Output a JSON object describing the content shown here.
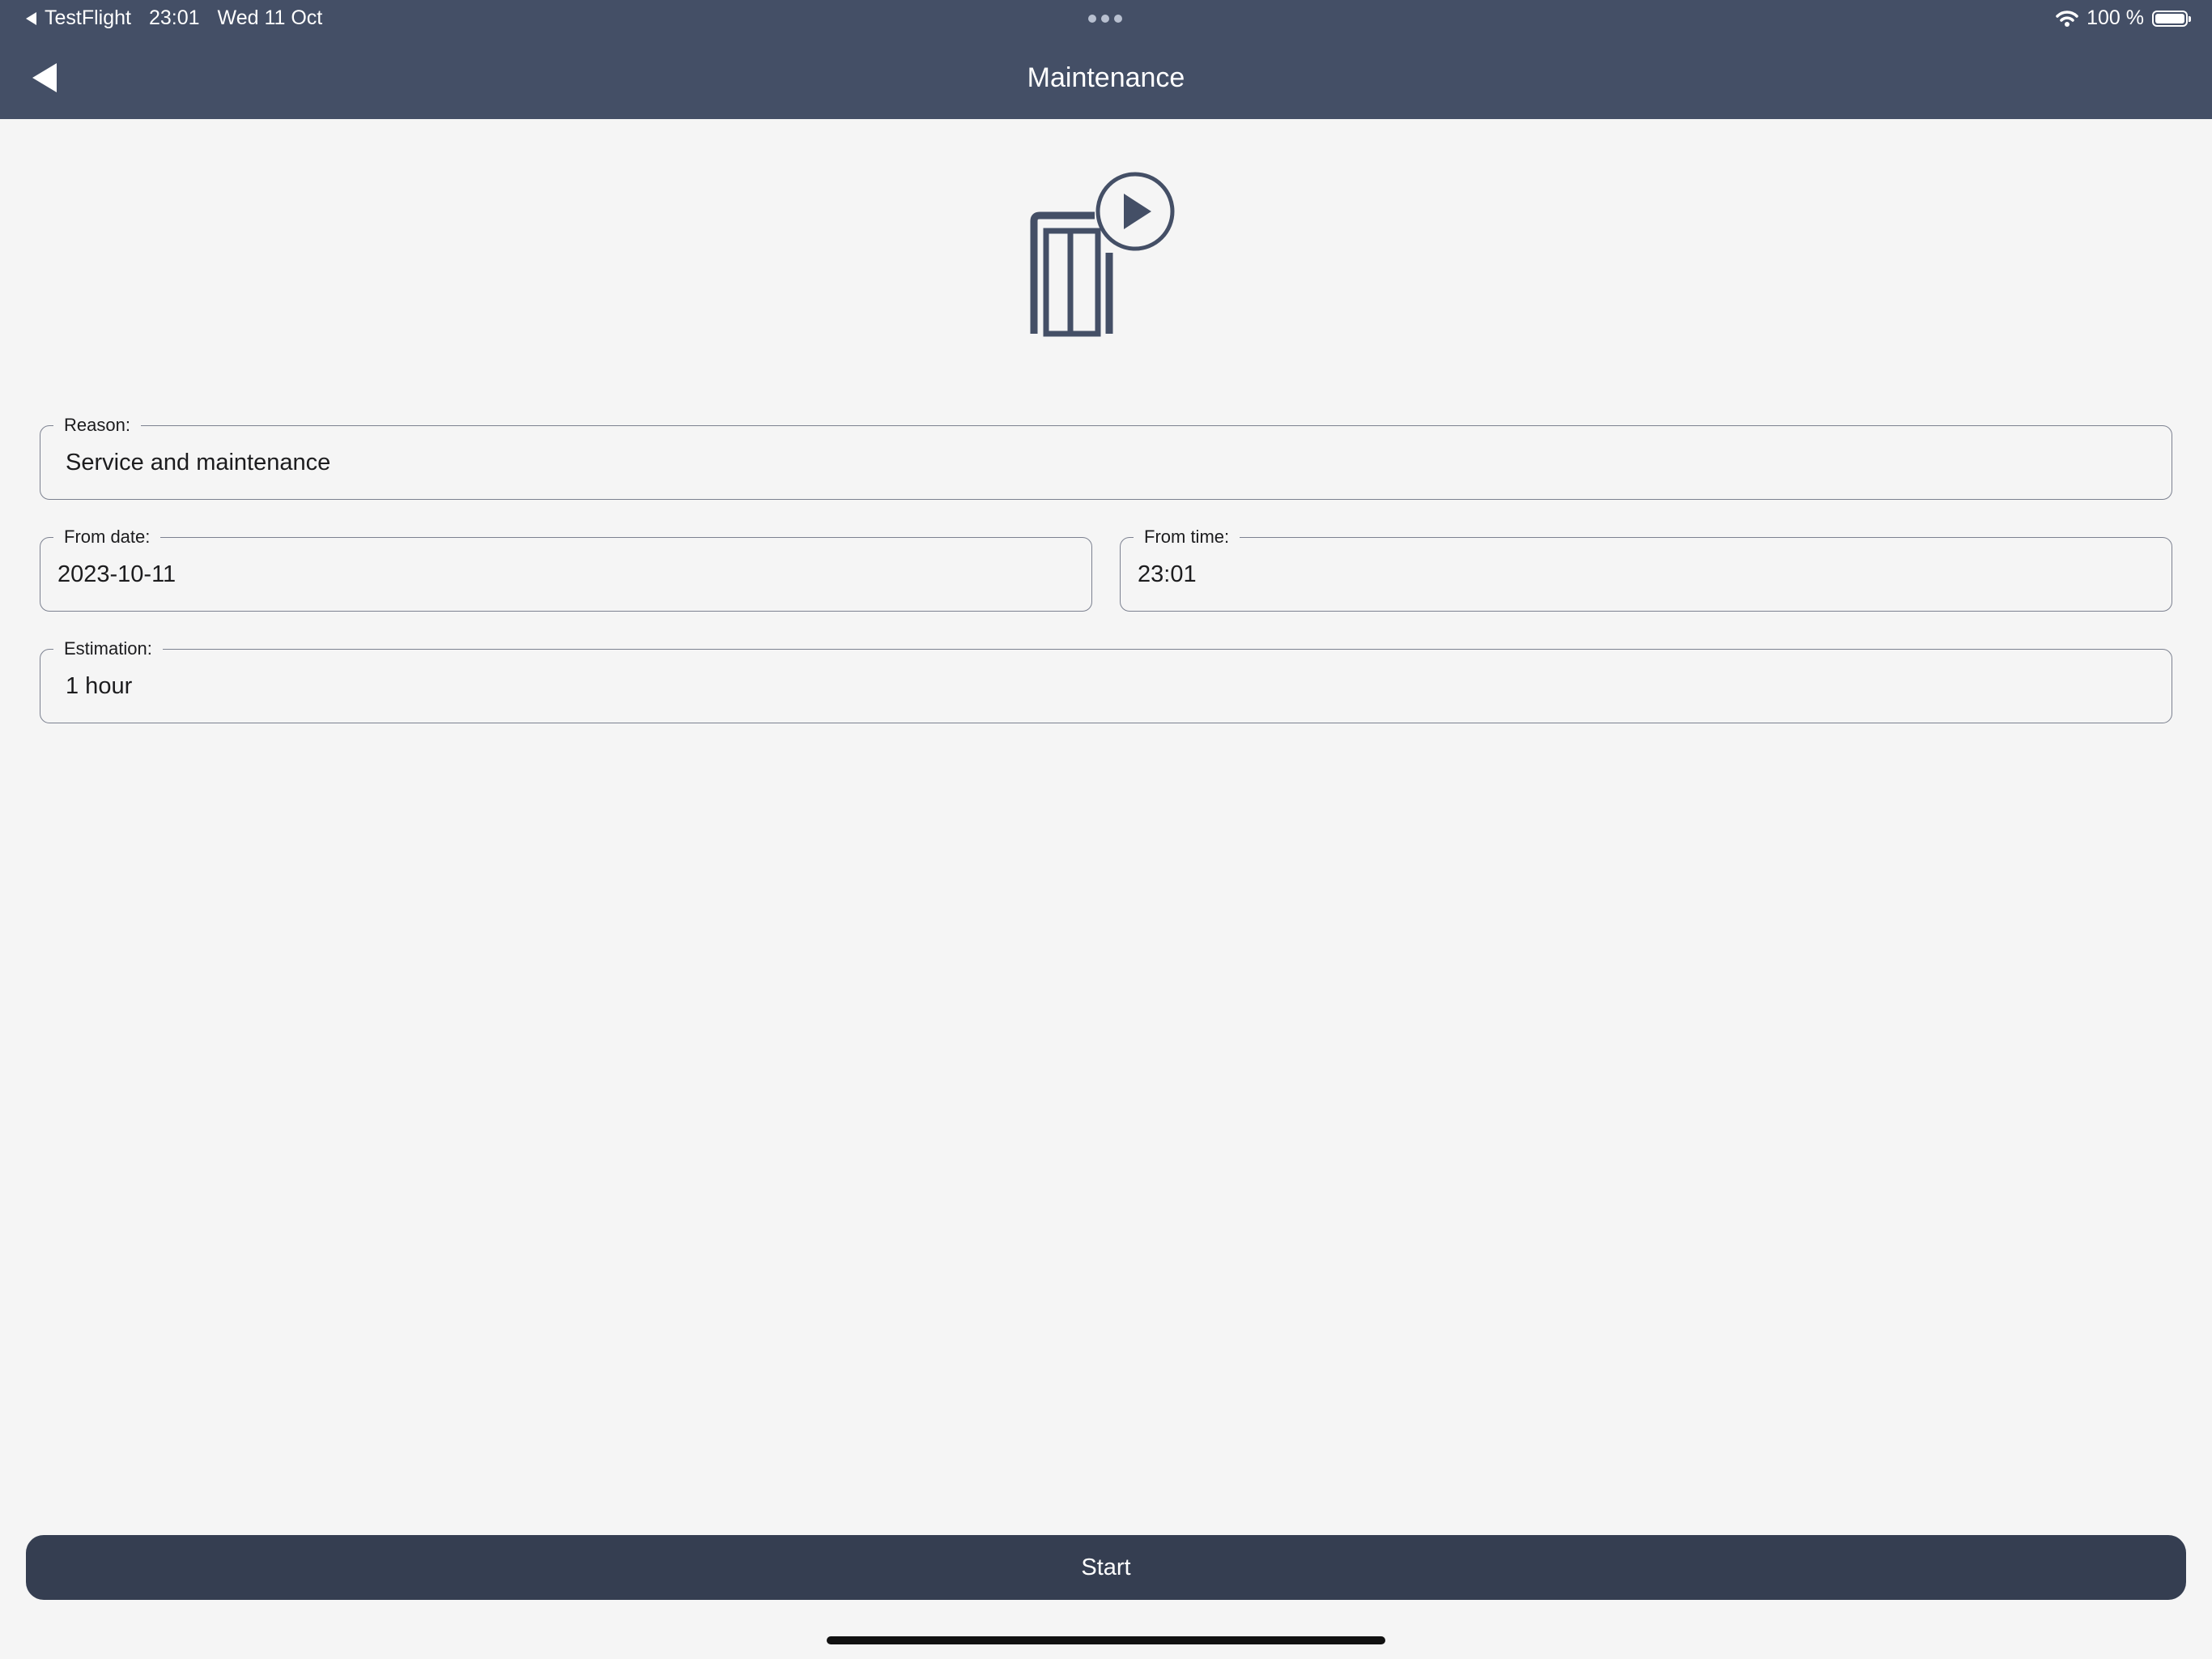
{
  "status_bar": {
    "back_app": "TestFlight",
    "time": "23:01",
    "date": "Wed 11 Oct",
    "battery": "100 %",
    "battery_level": 1.0,
    "wifi_icon": "wifi-icon",
    "multitask_icon": "more-dots-icon"
  },
  "nav": {
    "title": "Maintenance",
    "back_icon": "back-arrow-icon"
  },
  "hero": {
    "icon": "elevator-play-icon"
  },
  "form": {
    "reason": {
      "label": "Reason:",
      "value": "Service and maintenance"
    },
    "from_date": {
      "label": "From date:",
      "value": "2023-10-11"
    },
    "from_time": {
      "label": "From time:",
      "value": "23:01"
    },
    "estimation": {
      "label": "Estimation:",
      "value": "1 hour"
    }
  },
  "actions": {
    "start_label": "Start"
  },
  "colors": {
    "header": "#444f66",
    "background": "#f5f5f5",
    "button": "#353e51",
    "icon": "#444f66"
  }
}
